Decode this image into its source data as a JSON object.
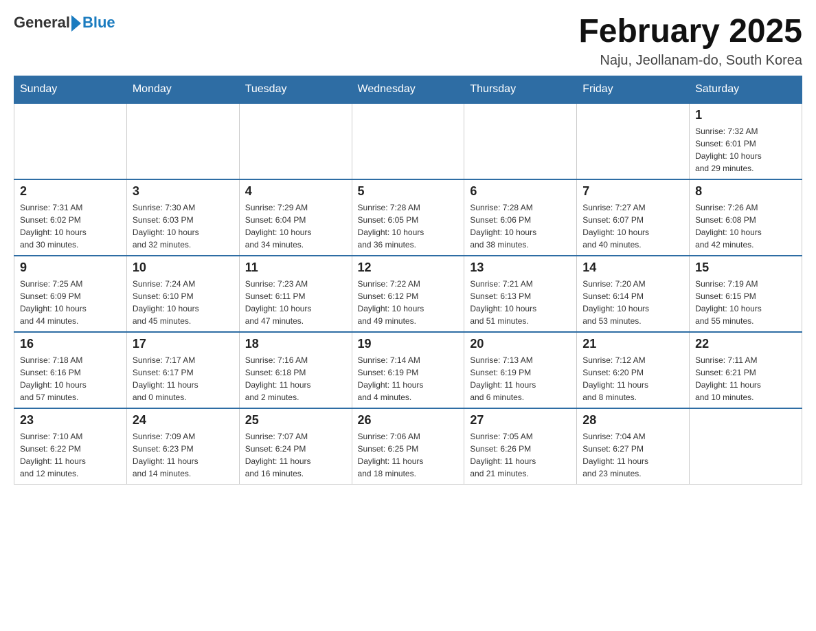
{
  "header": {
    "logo_general": "General",
    "logo_blue": "Blue",
    "title": "February 2025",
    "subtitle": "Naju, Jeollanam-do, South Korea"
  },
  "columns": [
    "Sunday",
    "Monday",
    "Tuesday",
    "Wednesday",
    "Thursday",
    "Friday",
    "Saturday"
  ],
  "weeks": [
    {
      "days": [
        {
          "number": "",
          "info": ""
        },
        {
          "number": "",
          "info": ""
        },
        {
          "number": "",
          "info": ""
        },
        {
          "number": "",
          "info": ""
        },
        {
          "number": "",
          "info": ""
        },
        {
          "number": "",
          "info": ""
        },
        {
          "number": "1",
          "info": "Sunrise: 7:32 AM\nSunset: 6:01 PM\nDaylight: 10 hours\nand 29 minutes."
        }
      ]
    },
    {
      "days": [
        {
          "number": "2",
          "info": "Sunrise: 7:31 AM\nSunset: 6:02 PM\nDaylight: 10 hours\nand 30 minutes."
        },
        {
          "number": "3",
          "info": "Sunrise: 7:30 AM\nSunset: 6:03 PM\nDaylight: 10 hours\nand 32 minutes."
        },
        {
          "number": "4",
          "info": "Sunrise: 7:29 AM\nSunset: 6:04 PM\nDaylight: 10 hours\nand 34 minutes."
        },
        {
          "number": "5",
          "info": "Sunrise: 7:28 AM\nSunset: 6:05 PM\nDaylight: 10 hours\nand 36 minutes."
        },
        {
          "number": "6",
          "info": "Sunrise: 7:28 AM\nSunset: 6:06 PM\nDaylight: 10 hours\nand 38 minutes."
        },
        {
          "number": "7",
          "info": "Sunrise: 7:27 AM\nSunset: 6:07 PM\nDaylight: 10 hours\nand 40 minutes."
        },
        {
          "number": "8",
          "info": "Sunrise: 7:26 AM\nSunset: 6:08 PM\nDaylight: 10 hours\nand 42 minutes."
        }
      ]
    },
    {
      "days": [
        {
          "number": "9",
          "info": "Sunrise: 7:25 AM\nSunset: 6:09 PM\nDaylight: 10 hours\nand 44 minutes."
        },
        {
          "number": "10",
          "info": "Sunrise: 7:24 AM\nSunset: 6:10 PM\nDaylight: 10 hours\nand 45 minutes."
        },
        {
          "number": "11",
          "info": "Sunrise: 7:23 AM\nSunset: 6:11 PM\nDaylight: 10 hours\nand 47 minutes."
        },
        {
          "number": "12",
          "info": "Sunrise: 7:22 AM\nSunset: 6:12 PM\nDaylight: 10 hours\nand 49 minutes."
        },
        {
          "number": "13",
          "info": "Sunrise: 7:21 AM\nSunset: 6:13 PM\nDaylight: 10 hours\nand 51 minutes."
        },
        {
          "number": "14",
          "info": "Sunrise: 7:20 AM\nSunset: 6:14 PM\nDaylight: 10 hours\nand 53 minutes."
        },
        {
          "number": "15",
          "info": "Sunrise: 7:19 AM\nSunset: 6:15 PM\nDaylight: 10 hours\nand 55 minutes."
        }
      ]
    },
    {
      "days": [
        {
          "number": "16",
          "info": "Sunrise: 7:18 AM\nSunset: 6:16 PM\nDaylight: 10 hours\nand 57 minutes."
        },
        {
          "number": "17",
          "info": "Sunrise: 7:17 AM\nSunset: 6:17 PM\nDaylight: 11 hours\nand 0 minutes."
        },
        {
          "number": "18",
          "info": "Sunrise: 7:16 AM\nSunset: 6:18 PM\nDaylight: 11 hours\nand 2 minutes."
        },
        {
          "number": "19",
          "info": "Sunrise: 7:14 AM\nSunset: 6:19 PM\nDaylight: 11 hours\nand 4 minutes."
        },
        {
          "number": "20",
          "info": "Sunrise: 7:13 AM\nSunset: 6:19 PM\nDaylight: 11 hours\nand 6 minutes."
        },
        {
          "number": "21",
          "info": "Sunrise: 7:12 AM\nSunset: 6:20 PM\nDaylight: 11 hours\nand 8 minutes."
        },
        {
          "number": "22",
          "info": "Sunrise: 7:11 AM\nSunset: 6:21 PM\nDaylight: 11 hours\nand 10 minutes."
        }
      ]
    },
    {
      "days": [
        {
          "number": "23",
          "info": "Sunrise: 7:10 AM\nSunset: 6:22 PM\nDaylight: 11 hours\nand 12 minutes."
        },
        {
          "number": "24",
          "info": "Sunrise: 7:09 AM\nSunset: 6:23 PM\nDaylight: 11 hours\nand 14 minutes."
        },
        {
          "number": "25",
          "info": "Sunrise: 7:07 AM\nSunset: 6:24 PM\nDaylight: 11 hours\nand 16 minutes."
        },
        {
          "number": "26",
          "info": "Sunrise: 7:06 AM\nSunset: 6:25 PM\nDaylight: 11 hours\nand 18 minutes."
        },
        {
          "number": "27",
          "info": "Sunrise: 7:05 AM\nSunset: 6:26 PM\nDaylight: 11 hours\nand 21 minutes."
        },
        {
          "number": "28",
          "info": "Sunrise: 7:04 AM\nSunset: 6:27 PM\nDaylight: 11 hours\nand 23 minutes."
        },
        {
          "number": "",
          "info": ""
        }
      ]
    }
  ]
}
